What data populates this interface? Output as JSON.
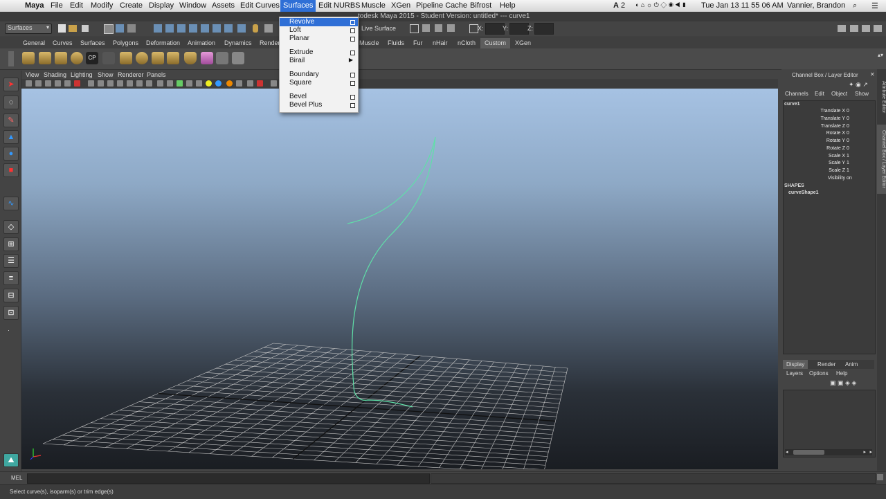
{
  "menubar": {
    "app_name": "Maya",
    "items": [
      "File",
      "Edit",
      "Modify",
      "Create",
      "Display",
      "Window",
      "Assets",
      "Edit Curves",
      "Surfaces",
      "Edit NURBS",
      "Muscle",
      "XGen",
      "Pipeline Cache",
      "Bifrost",
      "Help"
    ],
    "active_item": "Surfaces",
    "status_right": {
      "badge": "2",
      "clock": "Tue Jan 13  11 55 06 AM",
      "user": "Vannier, Brandon"
    }
  },
  "title": "todesk Maya 2015 - Student Version: untitled*   ---   curve1",
  "statusline": {
    "menuset": "Surfaces",
    "live_surface": "Live Surface",
    "x_label": "X:",
    "y_label": "Y:",
    "z_label": "Z:"
  },
  "shelf_tabs": [
    "General",
    "Curves",
    "Surfaces",
    "Polygons",
    "Deformation",
    "Animation",
    "Renderi",
    "Muscle",
    "Fluids",
    "Fur",
    "nHair",
    "nCloth",
    "Custom",
    "XGen"
  ],
  "active_shelf": "Custom",
  "panel_menu": [
    "View",
    "Shading",
    "Lighting",
    "Show",
    "Renderer",
    "Panels"
  ],
  "dropdown": {
    "items": [
      {
        "label": "Revolve",
        "option": true,
        "highlight": true
      },
      {
        "label": "Loft",
        "option": true
      },
      {
        "label": "Planar",
        "option": true
      },
      {
        "label": "Extrude",
        "option": true
      },
      {
        "label": "Birail",
        "submenu": true
      },
      {
        "label": "Boundary",
        "option": true
      },
      {
        "label": "Square",
        "option": true
      },
      {
        "label": "Bevel",
        "option": true
      },
      {
        "label": "Bevel Plus",
        "option": true
      }
    ]
  },
  "channel_box": {
    "header": "Channel Box / Layer Editor",
    "menu": [
      "Channels",
      "Edit",
      "Object",
      "Show"
    ],
    "object": "curve1",
    "attributes": [
      {
        "name": "Translate X",
        "value": "0"
      },
      {
        "name": "Translate Y",
        "value": "0"
      },
      {
        "name": "Translate Z",
        "value": "0"
      },
      {
        "name": "Rotate X",
        "value": "0"
      },
      {
        "name": "Rotate Y",
        "value": "0"
      },
      {
        "name": "Rotate Z",
        "value": "0"
      },
      {
        "name": "Scale X",
        "value": "1"
      },
      {
        "name": "Scale Y",
        "value": "1"
      },
      {
        "name": "Scale Z",
        "value": "1"
      },
      {
        "name": "Visibility",
        "value": "on"
      }
    ],
    "shapes_label": "SHAPES",
    "shape": "curveShape1"
  },
  "layer_editor": {
    "tabs": [
      "Display",
      "Render",
      "Anim"
    ],
    "active_tab": "Display",
    "menu": [
      "Layers",
      "Options",
      "Help"
    ]
  },
  "side_tabs": [
    "Attribute Editor",
    "Channel Box / Layer Editor"
  ],
  "cmdline": {
    "label": "MEL"
  },
  "helpline": {
    "text": "Select curve(s), isoparm(s) or trim edge(s)"
  },
  "colors": {
    "highlight": "#2f6fd6",
    "curve": "#5fe0a8",
    "grid": "#c8c8c8"
  }
}
